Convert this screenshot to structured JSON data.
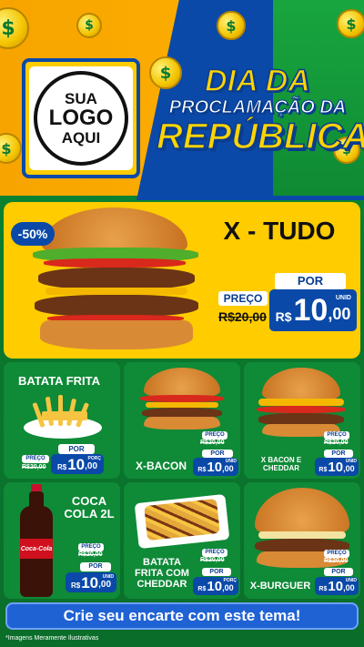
{
  "header": {
    "logo": {
      "line1": "SUA",
      "line2": "LOGO",
      "line3": "AQUI"
    },
    "title": {
      "line1": "DIA DA",
      "line2": "PROCLAMAÇÃO DA",
      "line3": "REPÚBLICA"
    },
    "coin_symbol": "$"
  },
  "featured": {
    "discount": "-50%",
    "name": "X - TUDO",
    "por_label": "POR",
    "preco_label": "PREÇO",
    "old_price": "R$20,00",
    "currency": "R$",
    "price_int": "10",
    "price_dec": ",00",
    "unit": "UNID"
  },
  "products": [
    {
      "name": "BATATA FRITA",
      "preco_label": "PREÇO",
      "old_price": "R$20,00",
      "por_label": "POR",
      "currency": "R$",
      "price_int": "10",
      "price_dec": ",00",
      "unit": "PORÇ"
    },
    {
      "name": "X-BACON",
      "preco_label": "PREÇO",
      "old_price": "R$20,00",
      "por_label": "POR",
      "currency": "R$",
      "price_int": "10",
      "price_dec": ",00",
      "unit": "UNID"
    },
    {
      "name": "X BACON E CHEDDAR",
      "preco_label": "PREÇO",
      "old_price": "R$20,00",
      "por_label": "POR",
      "currency": "R$",
      "price_int": "10",
      "price_dec": ",00",
      "unit": "UNID"
    },
    {
      "name": "COCA COLA 2L",
      "preco_label": "PREÇO",
      "old_price": "R$20,00",
      "por_label": "POR",
      "currency": "R$",
      "price_int": "10",
      "price_dec": ",00",
      "unit": "UNID"
    },
    {
      "name": "BATATA FRITA COM CHEDDAR",
      "preco_label": "PREÇO",
      "old_price": "R$20,00",
      "por_label": "POR",
      "currency": "R$",
      "price_int": "10",
      "price_dec": ",00",
      "unit": "PORÇ"
    },
    {
      "name": "X-BURGUER",
      "preco_label": "PREÇO",
      "old_price": "R$20,00",
      "por_label": "POR",
      "currency": "R$",
      "price_int": "10",
      "price_dec": ",00",
      "unit": "UNID"
    }
  ],
  "bottle_label": "Coca-Cola",
  "cta": "Crie seu encarte com este tema!",
  "footnote": "*Imagens Meramente Ilustrativas",
  "colors": {
    "brand_blue": "#0a49a8",
    "accent_yellow": "#ffcc00",
    "green": "#0f8a37",
    "orange": "#f7a400"
  }
}
